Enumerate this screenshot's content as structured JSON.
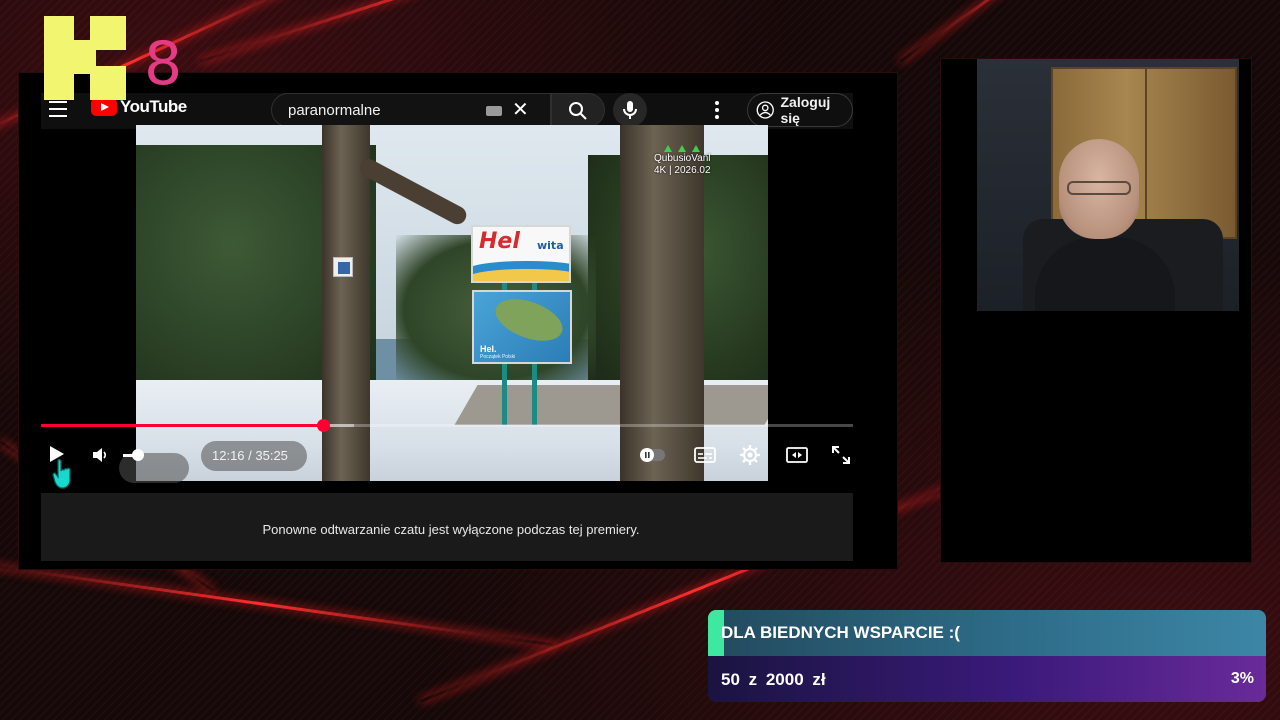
{
  "colors": {
    "accent_red": "#ff0033",
    "logo_yellow": "#f1f570",
    "logo_pink": "#e33b84",
    "goal_accent": "#3ee8a0"
  },
  "logo": {
    "digit": "8"
  },
  "youtube": {
    "logo_word": "YouTube",
    "search": {
      "query": "paranormalne"
    },
    "signin_label": "Zaloguj się",
    "video": {
      "sign_title": "Hel",
      "sign_subtitle": "wita",
      "map_label": "Hel.",
      "map_tagline": "Początek Polski",
      "watermark_line1": "QubusioVanl",
      "watermark_line2": "4K | 2026.02"
    },
    "player": {
      "time_display": "12:16 / 35:25",
      "progress_fraction": 0.347,
      "buffered_fraction": 0.386,
      "volume_fraction": 0.2
    },
    "chat_disabled_message": "Ponowne odtwarzanie czatu jest wyłączone podczas tej premiery."
  },
  "donation_goal": {
    "title": "DLA BIEDNYCH WSPARCIE :(",
    "progress_text": "50 z 2000 zł",
    "percent": "3%",
    "fraction": 0.025
  },
  "icons": [
    "hamburger-icon",
    "youtube-logo-icon",
    "keyboard-icon",
    "clear-icon",
    "search-icon",
    "mic-icon",
    "more-icon",
    "account-icon",
    "play-icon",
    "volume-icon",
    "autoplay-icon",
    "subtitles-icon",
    "settings-icon",
    "miniplayer-icon",
    "fullscreen-icon",
    "pointer-cursor-icon"
  ]
}
